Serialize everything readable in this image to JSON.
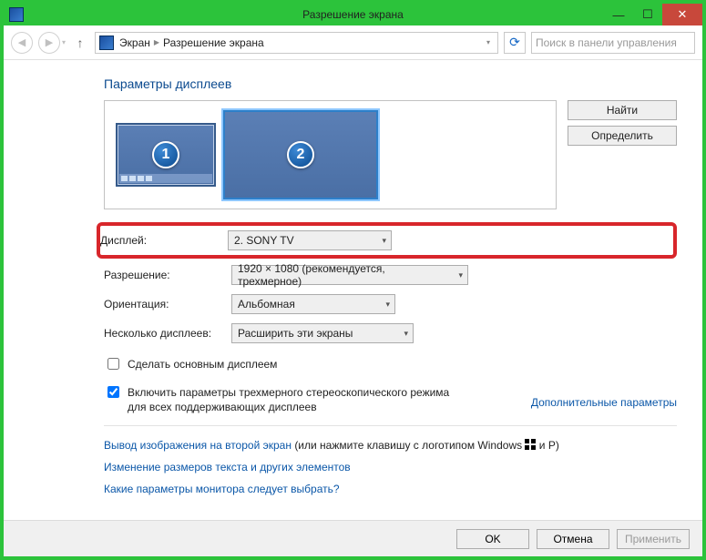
{
  "window": {
    "title": "Разрешение экрана",
    "minimize": "—",
    "maximize": "☐",
    "close": "✕"
  },
  "breadcrumb": {
    "item1": "Экран",
    "item2": "Разрешение экрана"
  },
  "search": {
    "placeholder": "Поиск в панели управления"
  },
  "heading": "Параметры дисплеев",
  "monitors": {
    "m1": "1",
    "m2": "2"
  },
  "buttons": {
    "find": "Найти",
    "detect": "Определить"
  },
  "form": {
    "display_label": "Дисплей:",
    "display_value": "2. SONY TV",
    "resolution_label": "Разрешение:",
    "resolution_value": "1920 × 1080 (рекомендуется, трехмерное)",
    "orientation_label": "Ориентация:",
    "orientation_value": "Альбомная",
    "multi_label": "Несколько дисплеев:",
    "multi_value": "Расширить эти экраны"
  },
  "checks": {
    "make_primary": "Сделать основным дисплеем",
    "stereo": "Включить параметры трехмерного стереоскопического режима для всех поддерживающих дисплеев"
  },
  "links": {
    "advanced": "Дополнительные параметры",
    "project_prefix": "Вывод изображения на второй экран",
    "project_suffix": " (или нажмите клавишу с логотипом Windows ",
    "project_end": " и P)",
    "textsize": "Изменение размеров текста и других элементов",
    "which": "Какие параметры монитора следует выбрать?"
  },
  "footer": {
    "ok": "OK",
    "cancel": "Отмена",
    "apply": "Применить"
  }
}
